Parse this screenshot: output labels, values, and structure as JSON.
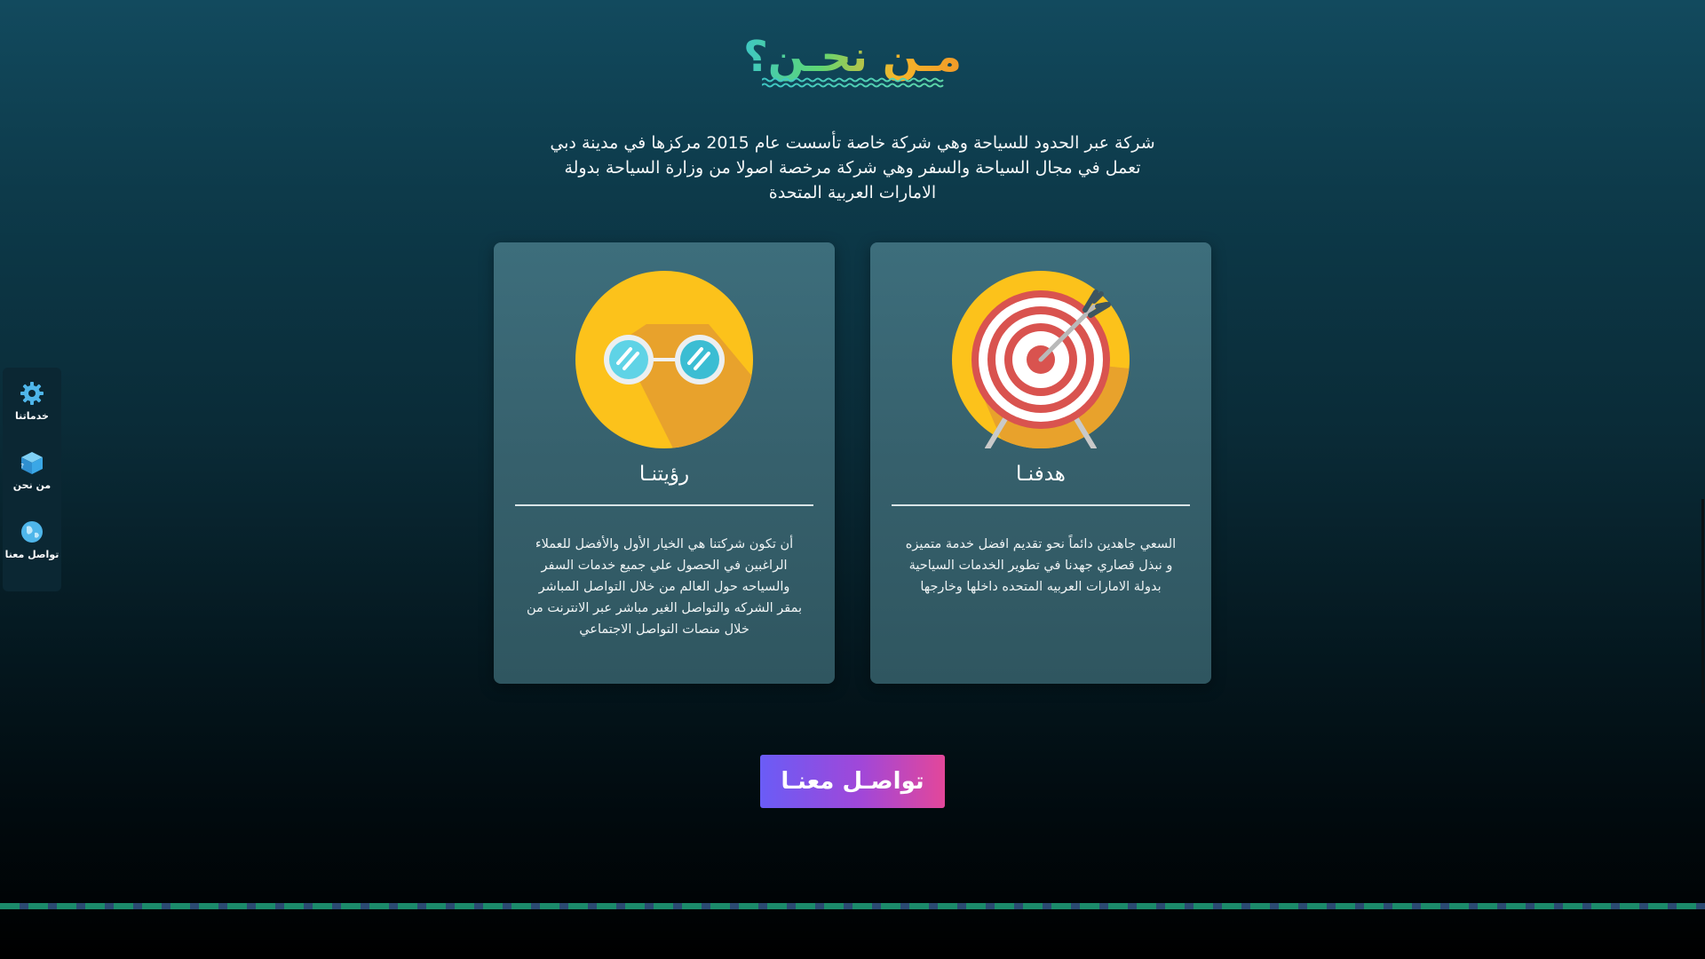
{
  "about": {
    "title": "مـن نحـن؟",
    "intro": "شركة عبر الحدود للسياحة وهي شركة خاصة تأسست عام 2015 مركزها في مدينة دبي تعمل في مجال السياحة والسفر وهي شركة مرخصة اصولا من وزارة السياحة بدولة الامارات العربية المتحدة"
  },
  "cards": {
    "vision": {
      "title": "رؤيتنـا",
      "text": "أن تكون شركتنا هي الخيار الأول والأفضل للعملاء الراغبين في الحصول علي جميع خدمات السفر والسياحه حول العالم من خلال التواصل المباشر بمقر الشركه والتواصل الغير مباشر عبر الانترنت من خلال منصات التواصل الاجتماعي",
      "icon": "glasses-icon"
    },
    "goal": {
      "title": "هدفنـا",
      "text": "السعي جاهدين دائماً نحو تقديم افضل خدمة متميزه و نبذل قصاري جهدنا في تطوير الخدمات السياحية بدولة الامارات العربيه المتحده داخلها وخارجها",
      "icon": "target-icon"
    }
  },
  "cta": {
    "label": "تواصـل معنـا"
  },
  "sidenav": {
    "items": [
      {
        "label": "خدماتنا",
        "icon": "gear-icon"
      },
      {
        "label": "من نحن",
        "icon": "cube-icon"
      },
      {
        "label": "تواصل معنا",
        "icon": "globe-icon"
      }
    ]
  },
  "colors": {
    "title_gradient": [
      "#f29a28",
      "#f6b62a",
      "#5ed673",
      "#3ec7c4"
    ],
    "cta_gradient": [
      "#6a5cf6",
      "#a147d8",
      "#e3479a"
    ],
    "card_bg": "#3d6e7c",
    "icon_circle": "#fcc21b"
  }
}
